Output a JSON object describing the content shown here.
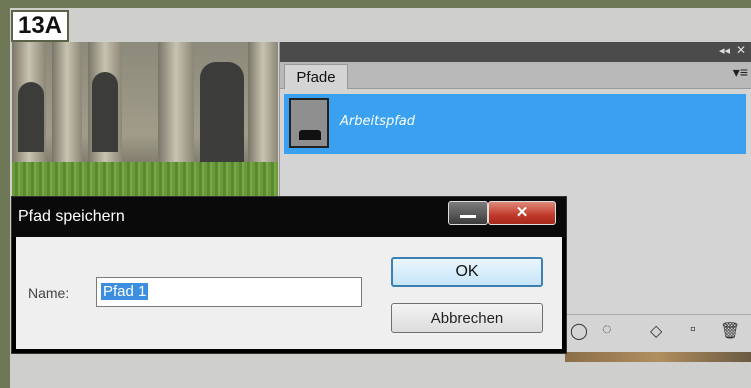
{
  "step_label": "13A",
  "panel": {
    "collapse_glyph": "◂◂",
    "close_glyph": "✕",
    "tab_label": "Pfade",
    "menu_glyph": "▾≡",
    "path_item_name": "Arbeitspfad"
  },
  "footer_icons": [
    "fill-path-icon",
    "stroke-path-icon",
    "selection-icon",
    "mask-icon",
    "new-path-icon",
    "trash-icon"
  ],
  "dialog": {
    "title": "Pfad speichern",
    "close_label": "✕",
    "name_label": "Name:",
    "name_value": "Pfad 1",
    "ok_label": "OK",
    "cancel_label": "Abbrechen"
  },
  "colors": {
    "selection_blue": "#3aa0f0",
    "frame_green": "#6e7756"
  }
}
